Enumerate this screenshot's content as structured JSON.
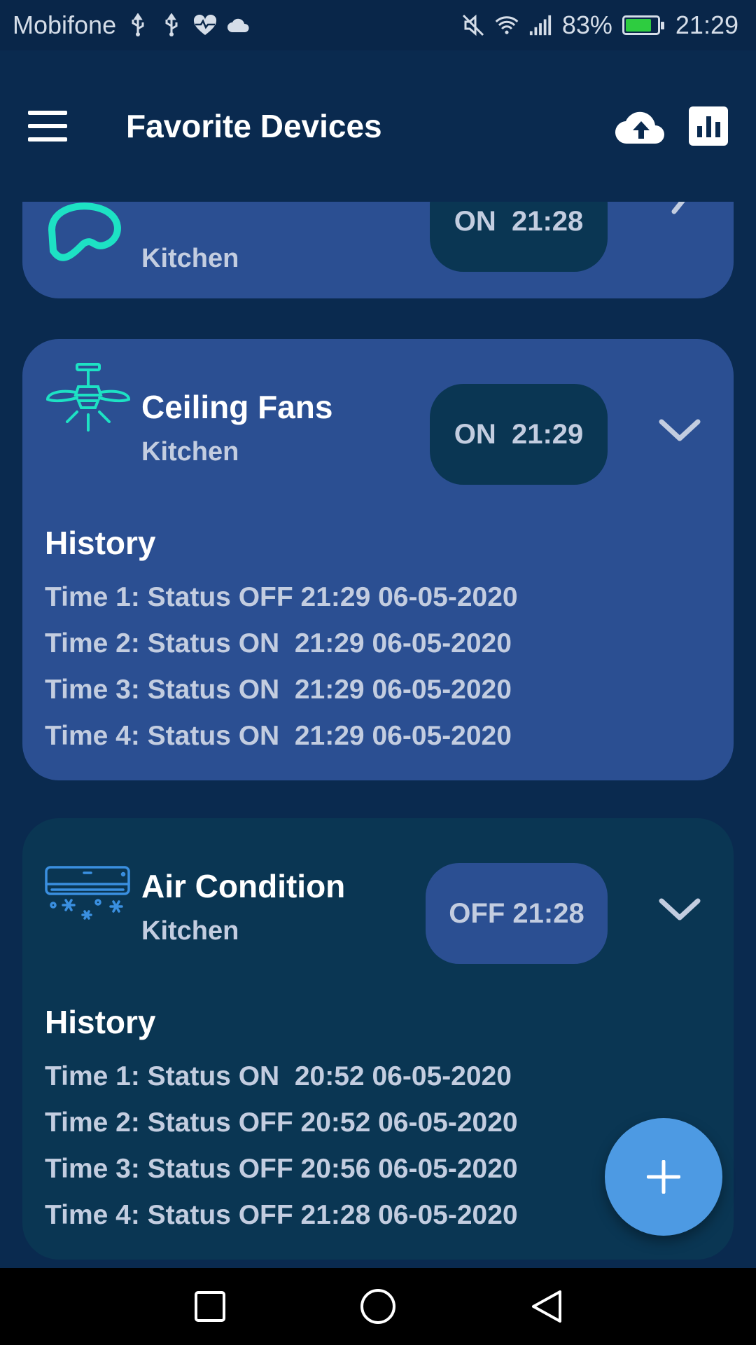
{
  "status_bar": {
    "carrier": "Mobifone",
    "battery_percent": "83%",
    "battery_level": 0.83,
    "time": "21:29",
    "icons": [
      "usb-icon",
      "usb-icon",
      "health-icon",
      "cloud-icon",
      "mute-icon",
      "wifi-icon",
      "signal-icon",
      "battery-icon"
    ]
  },
  "app_bar": {
    "title": "Favorite Devices",
    "icons": [
      "menu-icon",
      "cloud-upload-icon",
      "bar-chart-icon"
    ]
  },
  "cards": [
    {
      "name": "",
      "room": "Kitchen",
      "status": "ON  21:28",
      "icon": "device-icon"
    },
    {
      "name": "Ceiling Fans",
      "room": "Kitchen",
      "status": "ON  21:29",
      "icon": "ceiling-fan-icon",
      "history_title": "History",
      "history": [
        "Time 1: Status OFF 21:29 06-05-2020",
        "Time 2: Status ON  21:29 06-05-2020",
        "Time 3: Status ON  21:29 06-05-2020",
        "Time 4: Status ON  21:29 06-05-2020"
      ]
    },
    {
      "name": "Air Condition",
      "room": "Kitchen",
      "status": "OFF 21:28",
      "icon": "air-conditioner-icon",
      "history_title": "History",
      "history": [
        "Time 1: Status ON  20:52 06-05-2020",
        "Time 2: Status OFF 20:52 06-05-2020",
        "Time 3: Status OFF 20:56 06-05-2020",
        "Time 4: Status OFF 21:28 06-05-2020"
      ]
    }
  ],
  "colors": {
    "background": "#0a2a4f",
    "card_blue": "#2b4f92",
    "card_teal": "#0a3653",
    "accent_cyan": "#1de2c4",
    "fab": "#4d9ae3",
    "text_muted": "#c3cde0"
  }
}
